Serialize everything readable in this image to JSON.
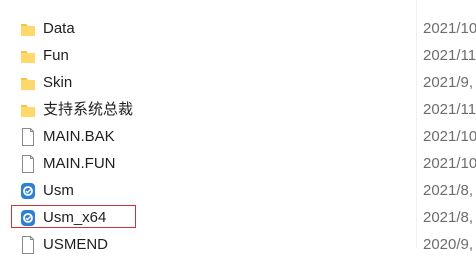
{
  "files": [
    {
      "name": "Data",
      "date": "2021/10",
      "type": "folder"
    },
    {
      "name": "Fun",
      "date": "2021/11",
      "type": "folder"
    },
    {
      "name": "Skin",
      "date": "2021/9,",
      "type": "folder"
    },
    {
      "name": "支持系统总裁",
      "date": "2021/11",
      "type": "folder"
    },
    {
      "name": "MAIN.BAK",
      "date": "2021/10",
      "type": "file"
    },
    {
      "name": "MAIN.FUN",
      "date": "2021/10",
      "type": "file"
    },
    {
      "name": "Usm",
      "date": "2021/8,",
      "type": "app"
    },
    {
      "name": "Usm_x64",
      "date": "2021/8,",
      "type": "app"
    },
    {
      "name": "USMEND",
      "date": "2020/9,",
      "type": "file"
    }
  ],
  "colors": {
    "folder": "#f3c34a",
    "app": "#2f7fd8",
    "highlight_border": "#c9353a"
  },
  "icons": {
    "folder": "folder-icon",
    "file": "file-icon",
    "app": "app-icon"
  }
}
